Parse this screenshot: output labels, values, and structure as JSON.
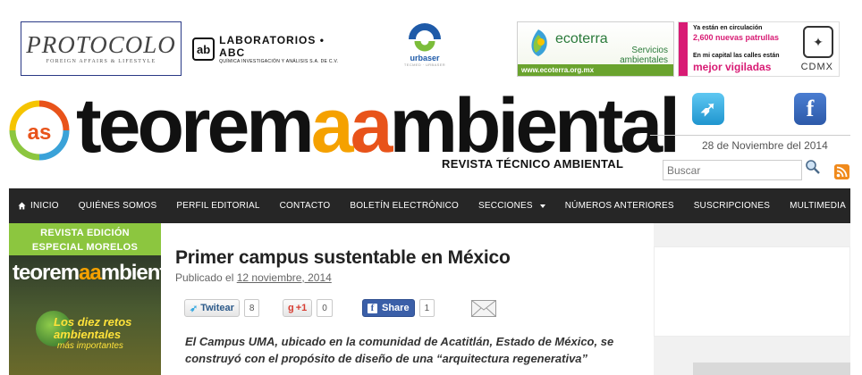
{
  "banner": {
    "protocolo": {
      "name": "PROTOCOLO",
      "tagline": "FOREIGN AFFAIRS & LIFESTYLE"
    },
    "laboratorios": {
      "name": "LABORATORIOS • ABC",
      "sub": "QUÍMICA INVESTIGACIÓN Y ANÁLISIS S.A. DE C.V."
    },
    "urbaser": {
      "name": "urbaser",
      "sub": "TECMED · URBASER"
    },
    "ecoterra": {
      "name": "ecoterra",
      "services": "Servicios ambientales",
      "url": "www.ecoterra.org.mx"
    },
    "cdmx": {
      "line1": "Ya están en circulación",
      "line2": "2,600 nuevas patrullas",
      "line3": "En mi capital las calles están",
      "line4": "mejor vigiladas",
      "brand": "CDMX"
    }
  },
  "masthead": {
    "logo_part1": "teorem",
    "logo_a1": "a",
    "logo_a2": "a",
    "logo_part2": "mbiental",
    "tagline": "REVISTA TÉCNICO AMBIENTAL"
  },
  "header_right": {
    "date": "28 de Noviembre del 2014",
    "search_placeholder": "Buscar"
  },
  "nav": {
    "items": [
      {
        "label": "INICIO"
      },
      {
        "label": "QUIÉNES SOMOS"
      },
      {
        "label": "PERFIL EDITORIAL"
      },
      {
        "label": "CONTACTO"
      },
      {
        "label": "BOLETÍN ELECTRÓNICO"
      },
      {
        "label": "SECCIONES"
      },
      {
        "label": "NÚMEROS ANTERIORES"
      },
      {
        "label": "SUSCRIPCIONES"
      },
      {
        "label": "MULTIMEDIA"
      }
    ]
  },
  "sidebar_left": {
    "edition_line1": "REVISTA EDICIÓN",
    "edition_line2": "ESPECIAL MORELOS",
    "cover_title1": "teorem",
    "cover_title2": "mbiental",
    "cover_headline": "Los diez retos ambientales",
    "cover_deck": "más importantes"
  },
  "article": {
    "title": "Primer campus sustentable en México",
    "published_prefix": "Publicado el ",
    "published_date": "12 noviembre, 2014",
    "lead": "El Campus UMA, ubicado en la comunidad de Acatitlán, Estado de México, se construyó con el propósito de diseño de una “arquitectura regenerativa”"
  },
  "share": {
    "twitter_label": "Twitear",
    "twitter_count": "8",
    "gplus_label": "+1",
    "gplus_count": "0",
    "facebook_label": "Share",
    "facebook_count": "1"
  },
  "colors": {
    "nav_bg": "#262626",
    "edition_green": "#8cc63f",
    "logo_orange": "#f5a100",
    "logo_red": "#e8531a",
    "cdmx_pink": "#d81b74"
  }
}
